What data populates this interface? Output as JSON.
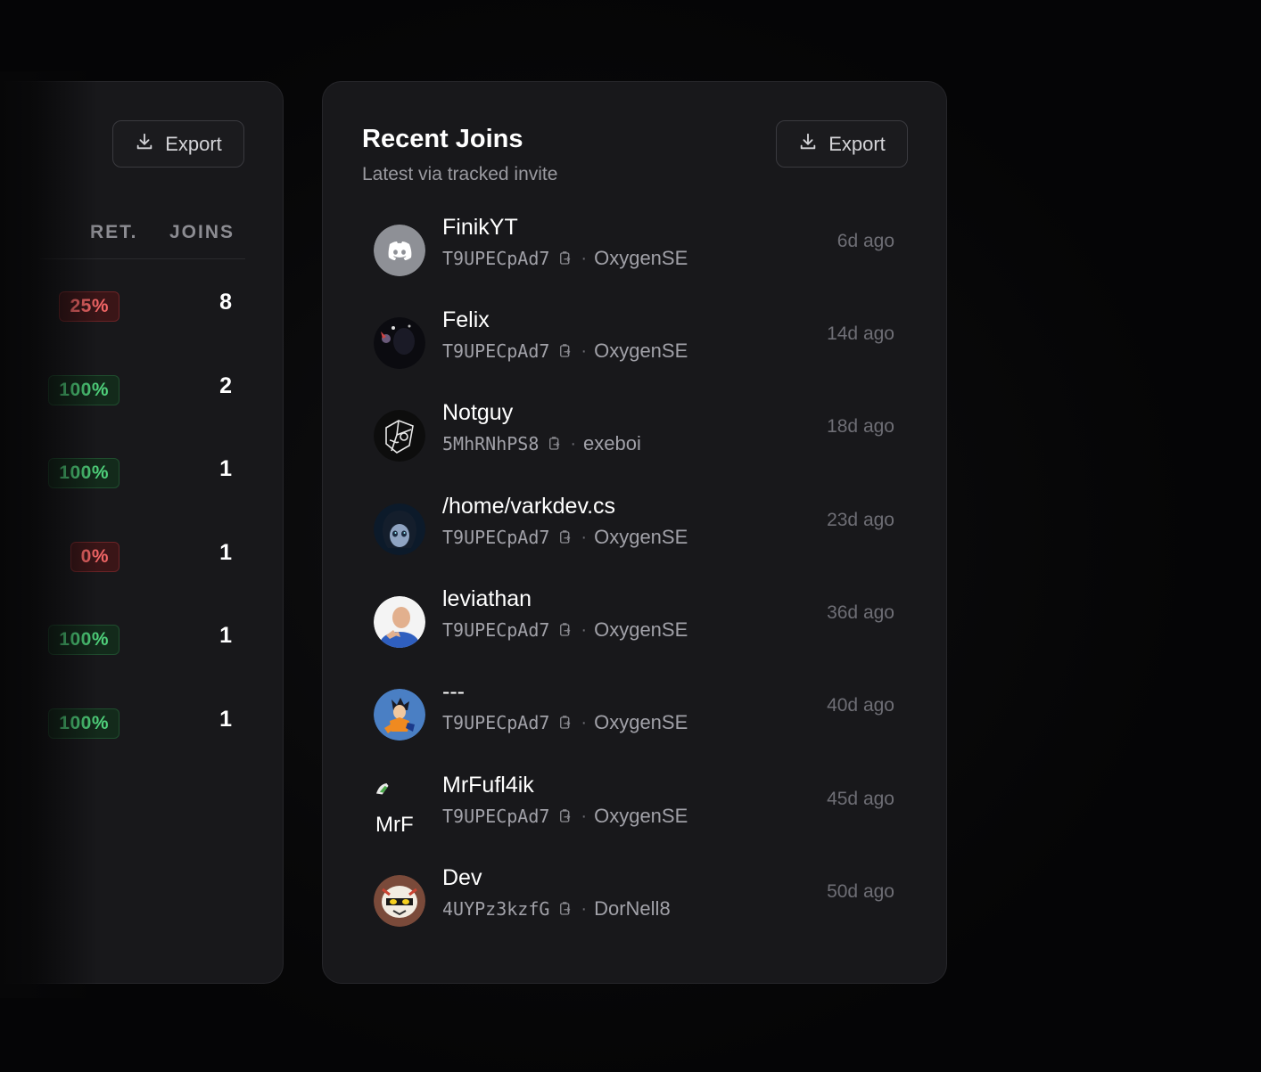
{
  "left_panel": {
    "export_label": "Export",
    "col_ret": "RET.",
    "col_joins": "JOINS",
    "rows": [
      {
        "ret": "25%",
        "joins": "8",
        "tone": "red"
      },
      {
        "ret": "100%",
        "joins": "2",
        "tone": "green"
      },
      {
        "ret": "100%",
        "joins": "1",
        "tone": "green"
      },
      {
        "ret": "0%",
        "joins": "1",
        "tone": "red"
      },
      {
        "ret": "100%",
        "joins": "1",
        "tone": "green"
      },
      {
        "ret": "100%",
        "joins": "1",
        "tone": "green"
      }
    ]
  },
  "recent_joins": {
    "title": "Recent Joins",
    "subtitle": "Latest via tracked invite",
    "export_label": "Export",
    "separator": "·",
    "items": [
      {
        "name": "FinikYT",
        "code": "T9UPECpAd7",
        "inviter": "OxygenSE",
        "time": "6d ago",
        "avatar": "discord-default"
      },
      {
        "name": "Felix",
        "code": "T9UPECpAd7",
        "inviter": "OxygenSE",
        "time": "14d ago",
        "avatar": "dark-figure"
      },
      {
        "name": "Notguy",
        "code": "5MhRNhPS8",
        "inviter": "exeboi",
        "time": "18d ago",
        "avatar": "sketch"
      },
      {
        "name": "/home/varkdev.cs",
        "code": "T9UPECpAd7",
        "inviter": "OxygenSE",
        "time": "23d ago",
        "avatar": "anime-girl"
      },
      {
        "name": "leviathan",
        "code": "T9UPECpAd7",
        "inviter": "OxygenSE",
        "time": "36d ago",
        "avatar": "man-blue"
      },
      {
        "name": "---",
        "code": "T9UPECpAd7",
        "inviter": "OxygenSE",
        "time": "40d ago",
        "avatar": "anime-fighter"
      },
      {
        "name": "MrFufl4ik",
        "code": "T9UPECpAd7",
        "inviter": "OxygenSE",
        "time": "45d ago",
        "avatar": "broken-image",
        "avatar_alt": "MrF"
      },
      {
        "name": "Dev",
        "code": "4UYPz3kzfG",
        "inviter": "DorNell8",
        "time": "50d ago",
        "avatar": "masked"
      }
    ]
  },
  "colors": {
    "card_bg": "#18181b",
    "badge_red": "#f06565",
    "badge_green": "#4fd17b"
  }
}
